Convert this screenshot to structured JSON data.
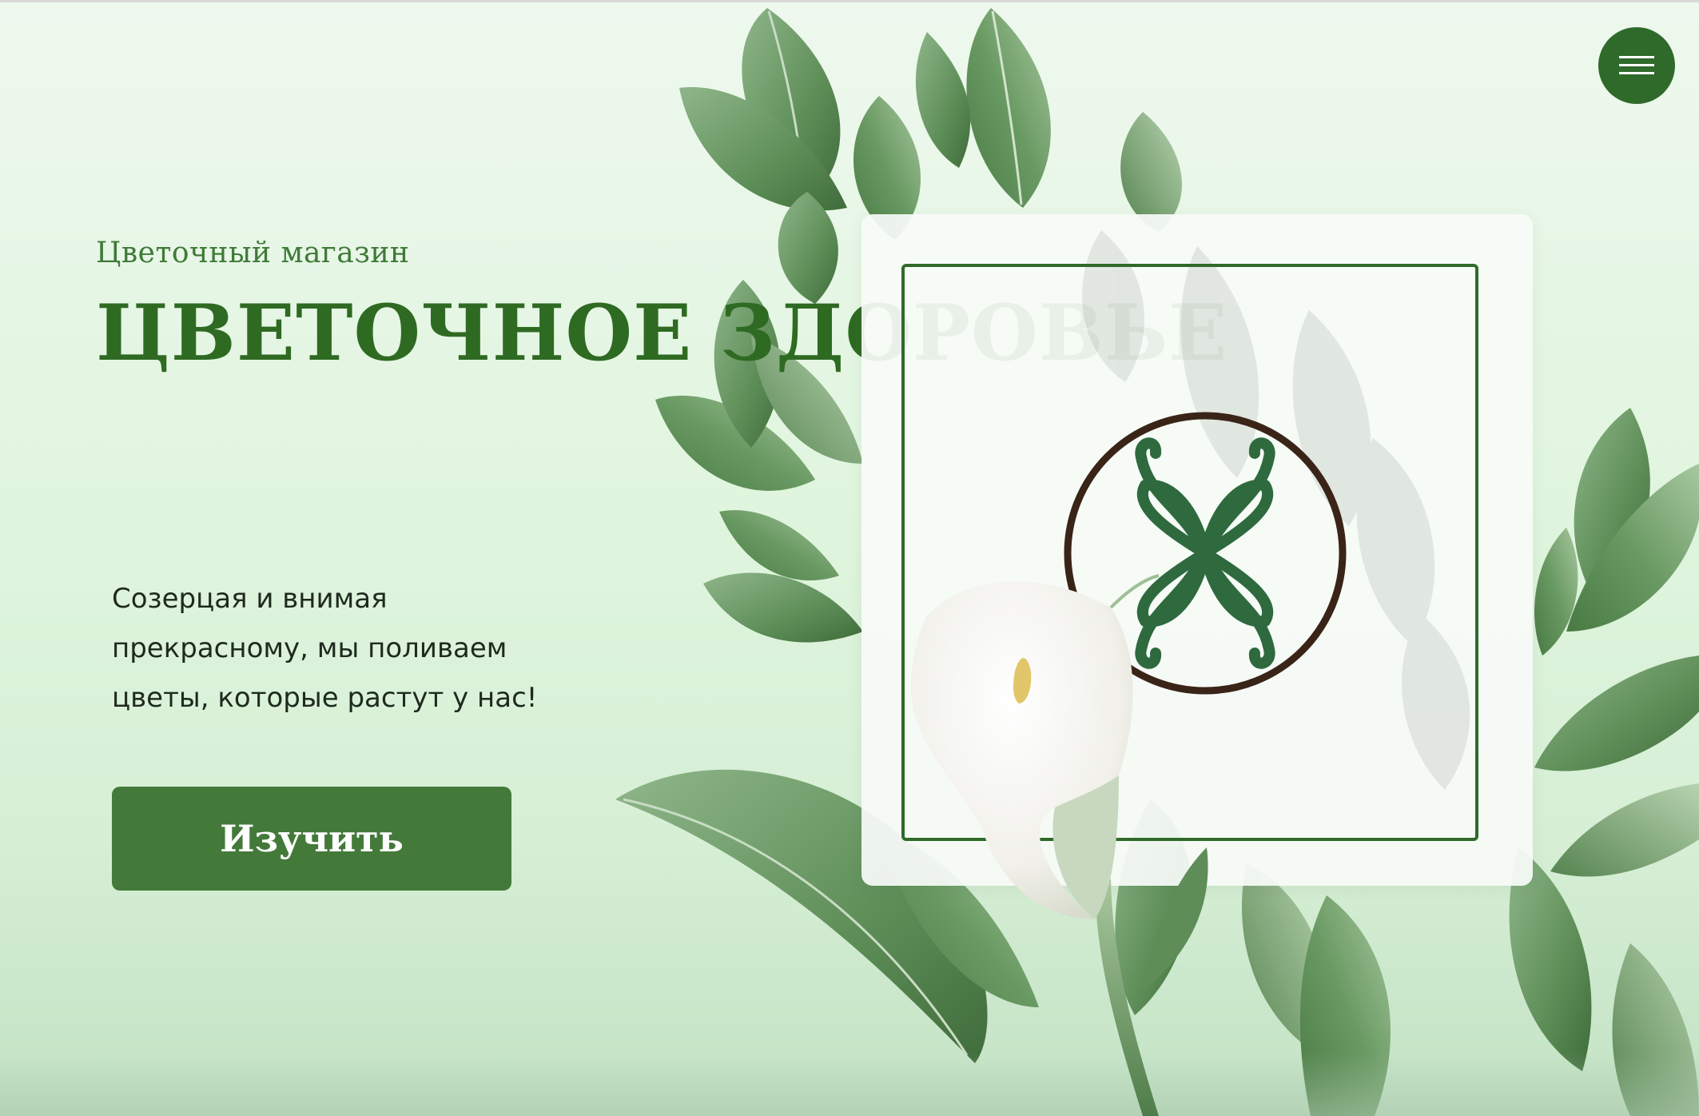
{
  "header": {
    "subtitle": "Цветочный магазин",
    "title": "ЦВЕТОЧНОЕ ЗДОРОВЬЕ",
    "menu_icon": "hamburger-menu-icon"
  },
  "hero": {
    "lead_line1": "Созерцая и внимая",
    "lead_line2": "прекрасному, мы поливаем",
    "lead_line3": "цветы, которые растут у нас!",
    "cta_label": "Изучить"
  },
  "card": {
    "logo_icon": "butterfly-logo-icon"
  },
  "colors": {
    "accent": "#2f6a2a",
    "button": "#437a39",
    "text": "#1f2a1e",
    "logo_ring": "#3a2418",
    "logo_mark": "#2e6a3e"
  }
}
